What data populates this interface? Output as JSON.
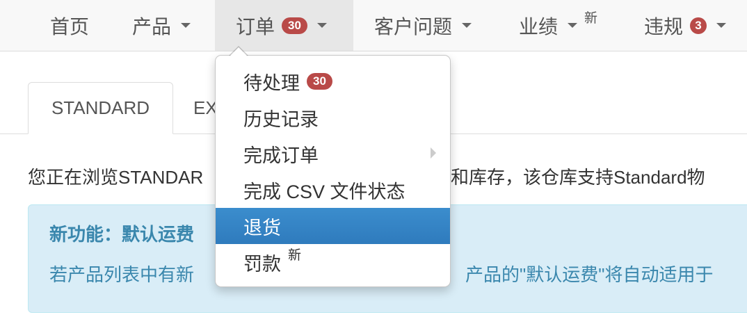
{
  "navbar": {
    "items": [
      {
        "label": "首页"
      },
      {
        "label": "产品"
      },
      {
        "label": "订单",
        "badge": "30"
      },
      {
        "label": "客户问题"
      },
      {
        "label": "业绩",
        "superscript": "新"
      },
      {
        "label": "违规",
        "badge": "3"
      }
    ]
  },
  "tabs": [
    {
      "label": "STANDARD"
    },
    {
      "label": "EX"
    }
  ],
  "intro": {
    "text_left": "您正在浏览STANDAR",
    "text_right": "和库存，该仓库支持Standard物"
  },
  "alert": {
    "title": "新功能：默认运费",
    "text_left": "若产品列表中有新",
    "text_right": "产品的\"默认运费\"将自动适用于"
  },
  "dropdown": {
    "items": [
      {
        "label": "待处理",
        "badge": "30"
      },
      {
        "label": "历史记录"
      },
      {
        "label": "完成订单"
      },
      {
        "label": "完成 CSV 文件状态"
      },
      {
        "label": "退货"
      },
      {
        "label": "罚款",
        "superscript": "新"
      }
    ]
  },
  "colors": {
    "badge": "#b94a48",
    "highlight": "#3580c3",
    "alert_bg": "#d9edf7",
    "alert_text": "#3a87ad"
  }
}
